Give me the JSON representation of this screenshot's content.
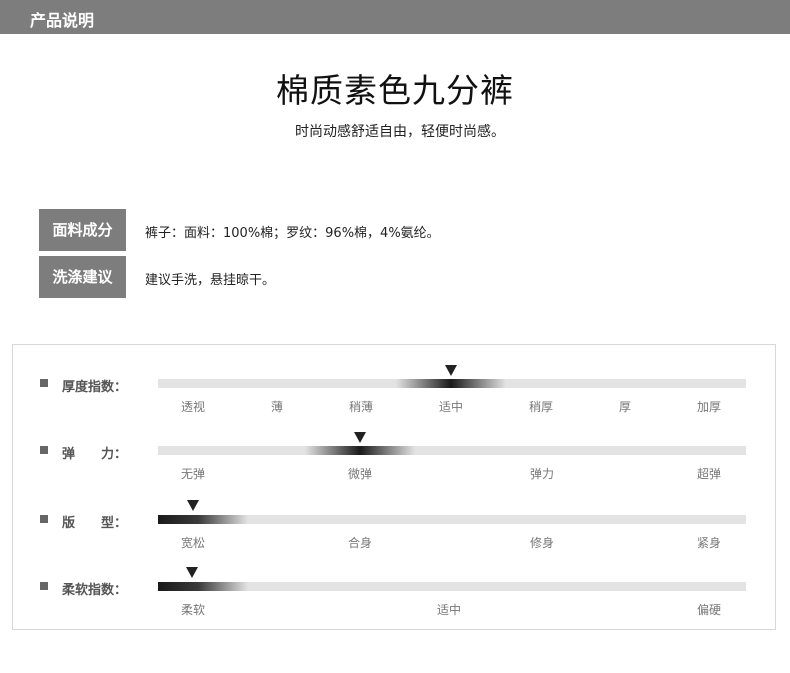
{
  "header": {
    "title": "产品说明"
  },
  "product": {
    "name": "棉质素色九分裤",
    "tagline": "时尚动感舒适自由，轻便时尚感。"
  },
  "info": [
    {
      "label": "面料成分",
      "value": "裤子：面料：100%棉；罗纹：96%棉，4%氨纶。"
    },
    {
      "label": "洗涤建议",
      "value": "建议手洗，悬挂晾干。"
    }
  ],
  "metrics": [
    {
      "label": "厚度指数：",
      "scale": [
        "透视",
        "薄",
        "稍薄",
        "适中",
        "稍厚",
        "厚",
        "加厚"
      ],
      "selected": "适中"
    },
    {
      "label": "弹　　力：",
      "scale": [
        "无弹",
        "微弹",
        "弹力",
        "超弹"
      ],
      "selected": "微弹"
    },
    {
      "label": "版　　型：",
      "scale": [
        "宽松",
        "合身",
        "修身",
        "紧身"
      ],
      "selected": "宽松"
    },
    {
      "label": "柔软指数：",
      "scale": [
        "柔软",
        "适中",
        "偏硬"
      ],
      "selected": "柔软"
    }
  ],
  "colors": {
    "header_bg": "#7d7d7d",
    "marker": "#222222",
    "track": "#e3e3e3"
  }
}
